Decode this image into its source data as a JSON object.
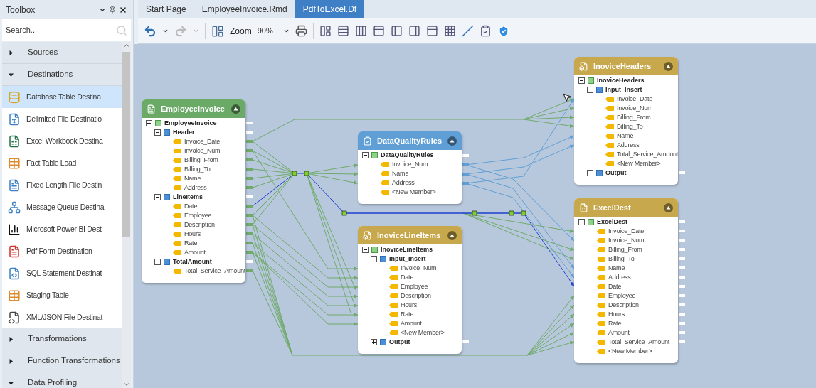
{
  "toolbox": {
    "title": "Toolbox",
    "search": {
      "placeholder": "Search..."
    },
    "items": [
      {
        "kind": "category",
        "label": "Sources",
        "expanded": false
      },
      {
        "kind": "category",
        "label": "Destinations",
        "expanded": true
      },
      {
        "kind": "tool",
        "label": "Database Table Destina",
        "selected": true
      },
      {
        "kind": "tool",
        "label": "Delimited File Destinatio",
        "selected": false
      },
      {
        "kind": "tool",
        "label": "Excel Workbook Destina",
        "selected": false
      },
      {
        "kind": "tool",
        "label": "Fact Table Load",
        "selected": false
      },
      {
        "kind": "tool",
        "label": "Fixed Length File Destin",
        "selected": false
      },
      {
        "kind": "tool",
        "label": "Message Queue Destina",
        "selected": false
      },
      {
        "kind": "tool",
        "label": "Microsoft Power BI Dest",
        "selected": false
      },
      {
        "kind": "tool",
        "label": "Pdf Form Destination",
        "selected": false
      },
      {
        "kind": "tool",
        "label": "SQL Statement Destinat",
        "selected": false
      },
      {
        "kind": "tool",
        "label": "Staging Table",
        "selected": false
      },
      {
        "kind": "tool",
        "label": "XML/JSON File Destinat",
        "selected": false
      },
      {
        "kind": "category",
        "label": "Transformations",
        "expanded": false
      },
      {
        "kind": "category",
        "label": "Function Transformations",
        "expanded": false
      },
      {
        "kind": "category",
        "label": "Data Profiling",
        "expanded": true
      }
    ]
  },
  "tabs": [
    {
      "label": "Start Page",
      "selected": false
    },
    {
      "label": "EmployeeInvoice.Rmd",
      "selected": false
    },
    {
      "label": "PdfToExcel.Df",
      "selected": true
    }
  ],
  "toolbar": {
    "zoom_label": "Zoom",
    "zoom_value": "90%"
  },
  "nodes": [
    {
      "title": "EmployeeInvoice",
      "color": "#6aaa66",
      "tree": [
        {
          "kind": "record",
          "label": "EmployeeInvoice",
          "expanded": true,
          "children": [
            {
              "kind": "group",
              "label": "Header",
              "expanded": true,
              "children": [
                {
                  "kind": "field",
                  "label": "Invoice_Date"
                },
                {
                  "kind": "field",
                  "label": "Invoice_Num"
                },
                {
                  "kind": "field",
                  "label": "Billing_From"
                },
                {
                  "kind": "field",
                  "label": "Billing_To"
                },
                {
                  "kind": "field",
                  "label": "Name"
                },
                {
                  "kind": "field",
                  "label": "Address"
                }
              ]
            },
            {
              "kind": "group",
              "label": "LineItems",
              "expanded": true,
              "children": [
                {
                  "kind": "field",
                  "label": "Date"
                },
                {
                  "kind": "field",
                  "label": "Employee"
                },
                {
                  "kind": "field",
                  "label": "Description"
                },
                {
                  "kind": "field",
                  "label": "Hours"
                },
                {
                  "kind": "field",
                  "label": "Rate"
                },
                {
                  "kind": "field",
                  "label": "Amount"
                }
              ]
            },
            {
              "kind": "group",
              "label": "TotalAmount",
              "expanded": true,
              "children": [
                {
                  "kind": "field",
                  "label": "Total_Service_Amount"
                }
              ]
            }
          ]
        }
      ]
    },
    {
      "title": "DataQualityRules",
      "color": "#5f9fd6",
      "tree": [
        {
          "kind": "record",
          "label": "DataQualityRules",
          "expanded": true,
          "children": [
            {
              "kind": "field",
              "label": "Invoice_Num"
            },
            {
              "kind": "field",
              "label": "Name"
            },
            {
              "kind": "field",
              "label": "Address"
            },
            {
              "kind": "field",
              "label": "<New Member>"
            }
          ]
        }
      ]
    },
    {
      "title": "InoviceLineItems",
      "color": "#c8a84c",
      "tree": [
        {
          "kind": "record",
          "label": "InoviceLineItems",
          "expanded": true,
          "children": [
            {
              "kind": "group",
              "label": "Input_Insert",
              "expanded": true,
              "children": [
                {
                  "kind": "field",
                  "label": "Invoice_Num"
                },
                {
                  "kind": "field",
                  "label": "Date"
                },
                {
                  "kind": "field",
                  "label": "Employee"
                },
                {
                  "kind": "field",
                  "label": "Description"
                },
                {
                  "kind": "field",
                  "label": "Hours"
                },
                {
                  "kind": "field",
                  "label": "Rate"
                },
                {
                  "kind": "field",
                  "label": "Amount"
                },
                {
                  "kind": "field",
                  "label": "<New Member>"
                }
              ]
            },
            {
              "kind": "group",
              "label": "Output",
              "expanded": false
            }
          ]
        }
      ]
    },
    {
      "title": "InoviceHeaders",
      "color": "#c8a84c",
      "tree": [
        {
          "kind": "record",
          "label": "InoviceHeaders",
          "expanded": true,
          "children": [
            {
              "kind": "group",
              "label": "Input_Insert",
              "expanded": true,
              "children": [
                {
                  "kind": "field",
                  "label": "Invoice_Date"
                },
                {
                  "kind": "field",
                  "label": "Invoice_Num"
                },
                {
                  "kind": "field",
                  "label": "Billing_From"
                },
                {
                  "kind": "field",
                  "label": "Billing_To"
                },
                {
                  "kind": "field",
                  "label": "Name"
                },
                {
                  "kind": "field",
                  "label": "Address"
                },
                {
                  "kind": "field",
                  "label": "Total_Service_Amount"
                },
                {
                  "kind": "field",
                  "label": "<New Member>"
                }
              ]
            },
            {
              "kind": "group",
              "label": "Output",
              "expanded": false
            }
          ]
        }
      ]
    },
    {
      "title": "ExcelDest",
      "color": "#c8a84c",
      "tree": [
        {
          "kind": "record",
          "label": "ExcelDest",
          "expanded": true,
          "children": [
            {
              "kind": "field",
              "label": "Invoice_Date"
            },
            {
              "kind": "field",
              "label": "Invoice_Num"
            },
            {
              "kind": "field",
              "label": "Billing_From"
            },
            {
              "kind": "field",
              "label": "Billing_To"
            },
            {
              "kind": "field",
              "label": "Name"
            },
            {
              "kind": "field",
              "label": "Address"
            },
            {
              "kind": "field",
              "label": "Date"
            },
            {
              "kind": "field",
              "label": "Employee"
            },
            {
              "kind": "field",
              "label": "Description"
            },
            {
              "kind": "field",
              "label": "Hours"
            },
            {
              "kind": "field",
              "label": "Rate"
            },
            {
              "kind": "field",
              "label": "Amount"
            },
            {
              "kind": "field",
              "label": "Total_Service_Amount"
            },
            {
              "kind": "field",
              "label": "<New Member>"
            }
          ]
        }
      ]
    }
  ]
}
